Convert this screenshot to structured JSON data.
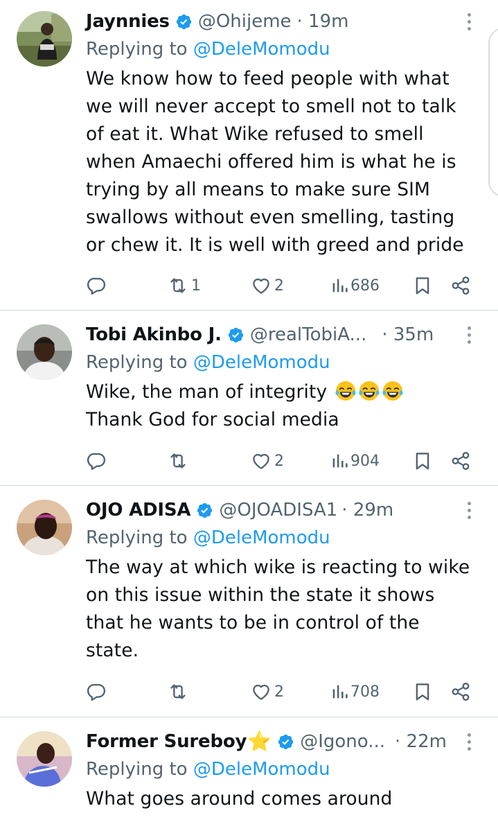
{
  "tweets": [
    {
      "display_name": "Jaynnies",
      "handle": "@Ohijeme",
      "time": "· 19m",
      "replying_prefix": "Replying to ",
      "replying_to": "@DeleMomodu",
      "text": "We know how to feed people with what\nwe will never accept to smell not to talk\nof eat it. What Wike refused to smell\nwhen Amaechi offered him is what he is\ntrying by all means to make sure SIM\nswallows without even smelling, tasting\nor chew it. It is well with greed and pride",
      "retweets": "1",
      "likes": "2",
      "views": "686"
    },
    {
      "display_name": "Tobi Akinbo J.",
      "handle": "@realTobiA...",
      "time": "· 35m",
      "replying_prefix": "Replying to ",
      "replying_to": "@DeleMomodu",
      "text_line1": "Wike, the man of integrity ",
      "text_line2": "Thank God for social media",
      "emoji_name": "face-with-tears-of-joy",
      "retweets": "",
      "likes": "2",
      "views": "904"
    },
    {
      "display_name": "OJO ADISA",
      "handle": "@OJOADISA1",
      "time": "· 29m",
      "replying_prefix": "Replying to ",
      "replying_to": "@DeleMomodu",
      "text": "The way at which wike is reacting to wike\non this issue within the state it shows\nthat he wants to be in control of the\nstate.",
      "retweets": "",
      "likes": "2",
      "views": "708"
    },
    {
      "display_name": "Former Sureboy",
      "name_emoji": "⭐",
      "handle": "@Igono...",
      "time": "· 22m",
      "replying_prefix": "Replying to ",
      "replying_to": "@DeleMomodu",
      "text": "What goes around comes around"
    }
  ],
  "icons": {
    "reply": "reply-icon",
    "retweet": "retweet-icon",
    "like": "heart-icon",
    "views": "views-icon",
    "bookmark": "bookmark-icon",
    "share": "share-icon",
    "verified": "verified-badge-icon",
    "more": "more-options-icon"
  },
  "colors": {
    "accent": "#1d9bf0",
    "muted": "#536471",
    "text": "#0f1419",
    "divider": "#cfd9de",
    "verified": "#1d9bf0"
  }
}
